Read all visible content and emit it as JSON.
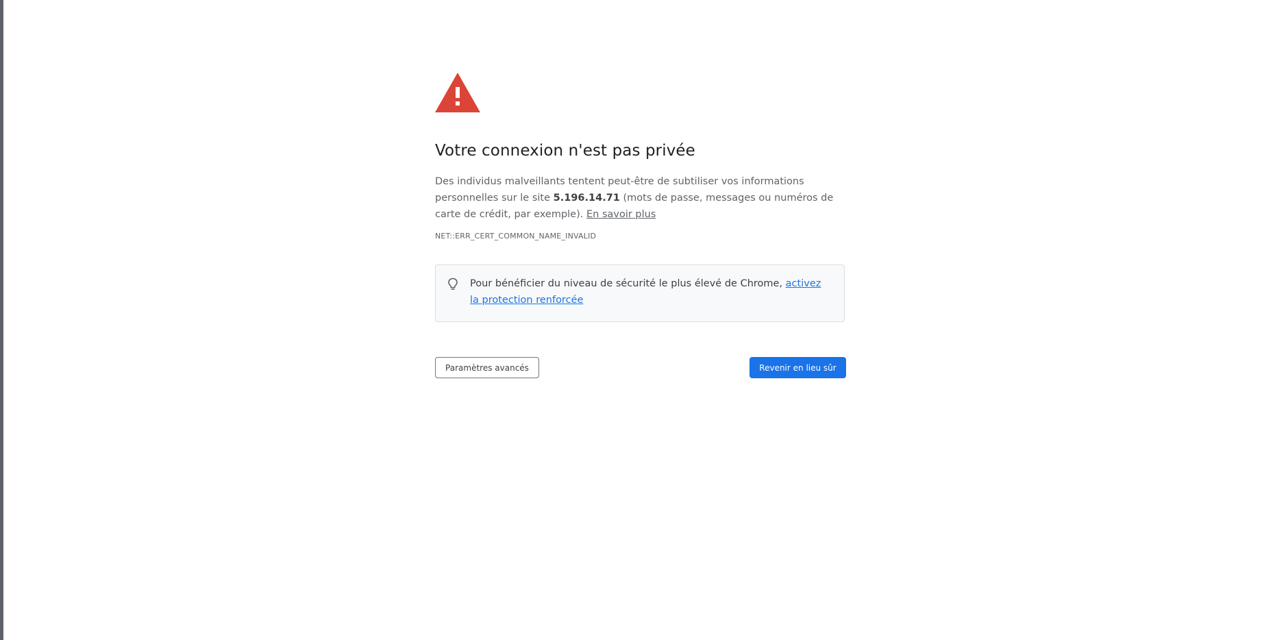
{
  "interstitial": {
    "icon": "warning-triangle-icon",
    "icon_color": "#db4437",
    "heading": "Votre connexion n'est pas privée",
    "explanation_before": "Des individus malveillants tentent peut-être de subtiliser vos informations personnelles sur le site ",
    "host": "5.196.14.71",
    "explanation_after": " (mots de passe, messages ou numéros de carte de crédit, par exemple). ",
    "learn_more": "En savoir plus",
    "error_code": "NET::ERR_CERT_COMMON_NAME_INVALID"
  },
  "enhanced_protection": {
    "icon": "lightbulb-icon",
    "text": "Pour bénéficier du niveau de sécurité le plus élevé de Chrome, ",
    "link": "activez la protection renforcée"
  },
  "buttons": {
    "advanced": "Paramètres avancés",
    "back_to_safety": "Revenir en lieu sûr"
  },
  "colors": {
    "primary_button": "#1a73e8",
    "link": "#1a73e8",
    "promo_background": "#f8f9fa"
  }
}
